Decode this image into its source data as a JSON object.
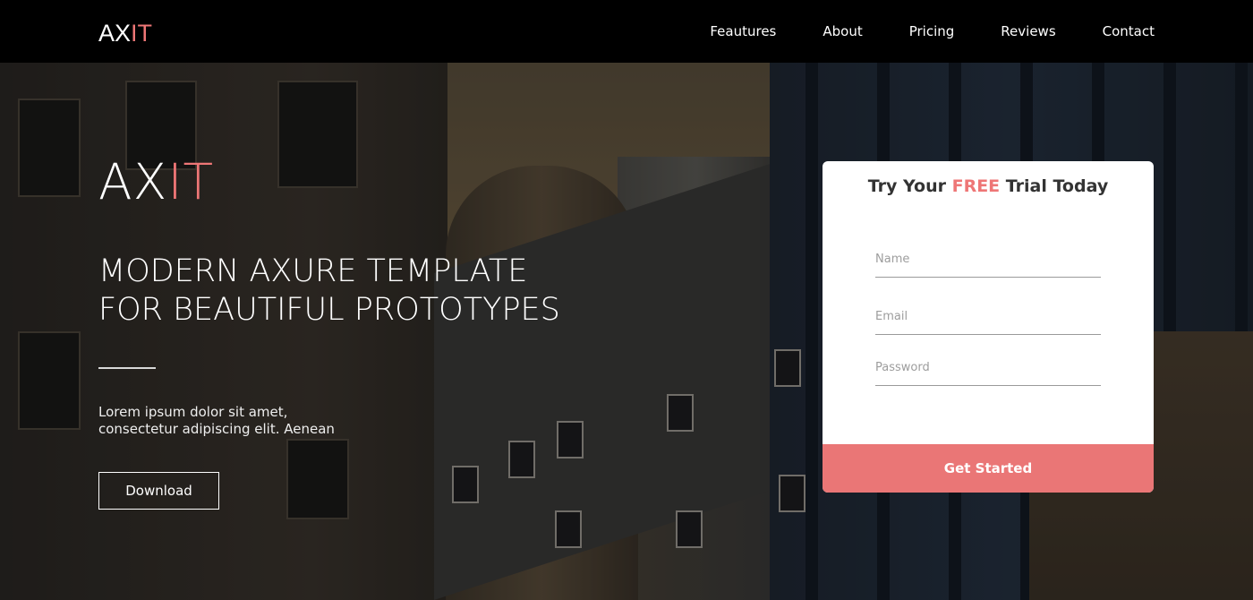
{
  "nav": {
    "logo_main": "AX",
    "logo_accent": "IT",
    "links": [
      "Feautures",
      "About",
      "Pricing",
      "Reviews",
      "Contact"
    ]
  },
  "hero": {
    "logo_main": "AX",
    "logo_accent": "IT",
    "headline_line1": "MODERN AXURE TEMPLATE",
    "headline_line2": "FOR BEAUTIFUL PROTOTYPES",
    "subtext_line1": "Lorem ipsum dolor sit amet,",
    "subtext_line2": "consectetur adipiscing elit. Aenean",
    "download_label": "Download"
  },
  "form": {
    "title_pre": "Try Your ",
    "title_highlight": "FREE",
    "title_post": " Trial Today",
    "name_placeholder": "Name",
    "email_placeholder": "Email",
    "password_placeholder": "Password",
    "submit_label": "Get Started"
  },
  "colors": {
    "accent": "#ee7676",
    "nav_bg": "#000000",
    "button_bg": "#ea7676"
  }
}
